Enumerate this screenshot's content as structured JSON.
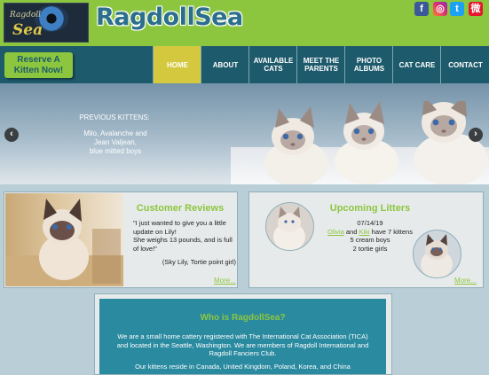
{
  "header": {
    "logo_small": "Ragdoll",
    "logo_big": "Sea",
    "brand": "RagdollSea",
    "social": [
      {
        "name": "facebook-icon",
        "glyph": "f",
        "color": "#3b5998"
      },
      {
        "name": "instagram-icon",
        "glyph": "◎",
        "color": "#dd2a7b"
      },
      {
        "name": "twitter-icon",
        "glyph": "t",
        "color": "#1da1f2"
      },
      {
        "name": "weibo-icon",
        "glyph": "微",
        "color": "#e6162d"
      }
    ]
  },
  "nav": {
    "cta_line1": "Reserve A",
    "cta_line2": "Kitten Now!",
    "items": [
      {
        "label": "HOME",
        "active": true
      },
      {
        "label": "ABOUT"
      },
      {
        "label": "AVAILABLE\nCATS"
      },
      {
        "label": "MEET THE\nPARENTS"
      },
      {
        "label": "PHOTO\nALBUMS"
      },
      {
        "label": "CAT CARE"
      },
      {
        "label": "CONTACT"
      }
    ]
  },
  "hero": {
    "title": "PREVIOUS KITTENS:",
    "line1": "Milo, Avalanche and",
    "line2": "Jean Valjean,",
    "line3": "blue mitted boys",
    "prev_arrow": "‹",
    "next_arrow": "›"
  },
  "reviews": {
    "title": "Customer Reviews",
    "line1": "\"I just wanted to give you a little",
    "line2": "update on Lily!",
    "line3": "She weighs 13 pounds, and is full",
    "line4": "of love!\"",
    "attribution": "(Sky Lily, Tortie point girl)",
    "more": "More..."
  },
  "litters": {
    "title": "Upcoming Litters",
    "date": "07/14/19",
    "mother1": "Olivia",
    "and": " and ",
    "mother2": "Kiki",
    "kittens": " have 7 kittens",
    "boys": "5 cream boys",
    "girls": "2 tortie girls",
    "more": "More..."
  },
  "about": {
    "title": "Who is RagdollSea?",
    "p1_line1": "We are a small home cattery registered with The International Cat Association (TICA)",
    "p1_line2": "and located in the Seattle, Washington. We are members of Ragdoll International and",
    "p1_line3": "Ragdoll Fanciers Club.",
    "p2_line1": "Our kittens reside in Canada, United Kingdom, Poland, Korea, and China"
  },
  "colors": {
    "header_green": "#8cc63f",
    "nav_teal": "#1d5a6b",
    "nav_active": "#d4c93e",
    "about_teal": "#2a8aa0",
    "page_bg": "#b9ced6"
  }
}
